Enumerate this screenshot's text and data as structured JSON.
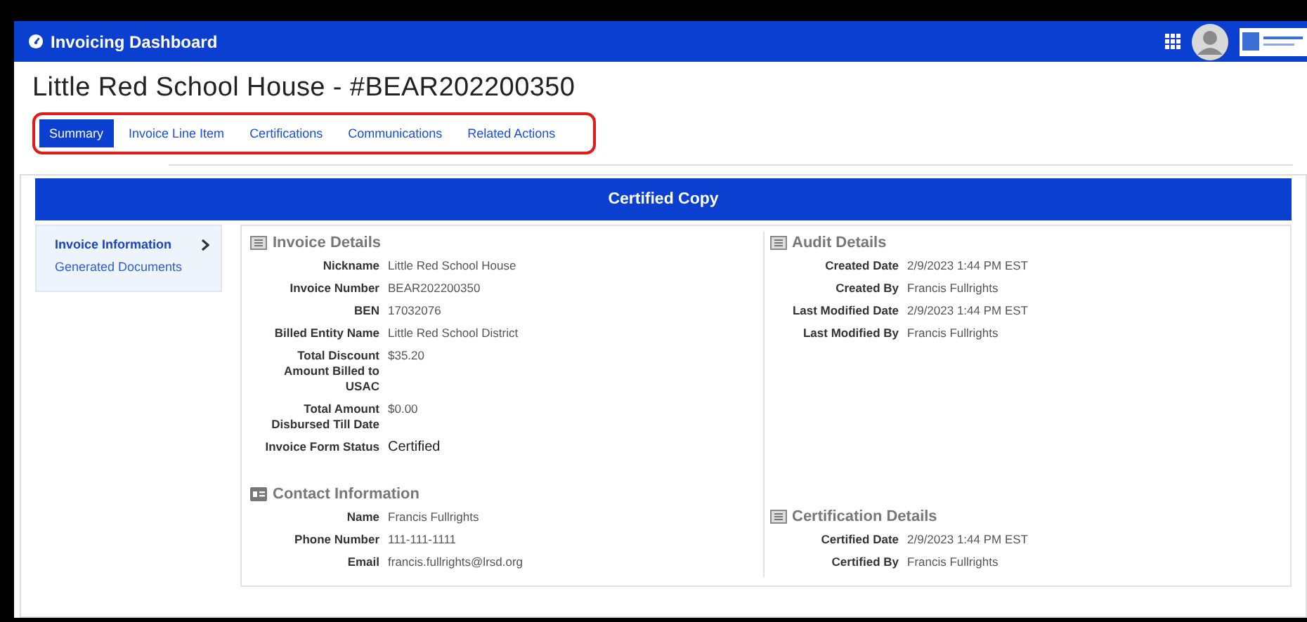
{
  "header": {
    "title": "Invoicing Dashboard"
  },
  "page_title": "Little Red School House - #BEAR202200350",
  "tabs_highlighted": true,
  "tabs": [
    {
      "label": "Summary",
      "selected": true
    },
    {
      "label": "Invoice Line Item",
      "selected": false
    },
    {
      "label": "Certifications",
      "selected": false
    },
    {
      "label": "Communications",
      "selected": false
    },
    {
      "label": "Related Actions",
      "selected": false
    }
  ],
  "banner": "Certified Copy",
  "sidebar": {
    "items": [
      {
        "label": "Invoice Information",
        "selected": true
      },
      {
        "label": "Generated Documents",
        "selected": false
      }
    ]
  },
  "columns": [
    {
      "sections": [
        {
          "title": "Invoice Details",
          "kind": "list",
          "fields": [
            {
              "label": "Nickname",
              "value": "Little Red School House",
              "kind": "plain"
            },
            {
              "label": "Invoice Number",
              "value": "BEAR202200350",
              "kind": "plain"
            },
            {
              "label": "BEN",
              "value": "17032076",
              "kind": "plain"
            },
            {
              "label": "Billed Entity Name",
              "value": "Little Red School District",
              "kind": "plain"
            },
            {
              "label": "Total Discount Amount Billed to USAC",
              "value": "$35.20",
              "kind": "plain"
            },
            {
              "label": "Total Amount Disbursed Till Date",
              "value": "$0.00",
              "kind": "plain"
            },
            {
              "label": "Invoice Form Status",
              "value": "Certified",
              "kind": "status"
            }
          ]
        },
        {
          "title": "Contact Information",
          "kind": "card",
          "fields": [
            {
              "label": "Name",
              "value": "Francis Fullrights",
              "kind": "plain"
            },
            {
              "label": "Phone Number",
              "value": "111-111-1111",
              "kind": "plain"
            },
            {
              "label": "Email",
              "value": "francis.fullrights@lrsd.org",
              "kind": "plain"
            }
          ]
        }
      ]
    },
    {
      "sections": [
        {
          "title": "Audit Details",
          "kind": "list",
          "fields": [
            {
              "label": "Created Date",
              "value": "2/9/2023 1:44 PM EST",
              "kind": "plain"
            },
            {
              "label": "Created By",
              "value": "Francis Fullrights",
              "kind": "plain"
            },
            {
              "label": "Last Modified Date",
              "value": "2/9/2023 1:44 PM EST",
              "kind": "plain"
            },
            {
              "label": "Last Modified By",
              "value": "Francis Fullrights",
              "kind": "plain"
            }
          ]
        },
        {
          "title": "Certification Details",
          "kind": "list",
          "fields": [
            {
              "label": "Certified Date",
              "value": "2/9/2023 1:44 PM EST",
              "kind": "plain"
            },
            {
              "label": "Certified By",
              "value": "Francis Fullrights",
              "kind": "plain"
            }
          ]
        }
      ]
    }
  ]
}
